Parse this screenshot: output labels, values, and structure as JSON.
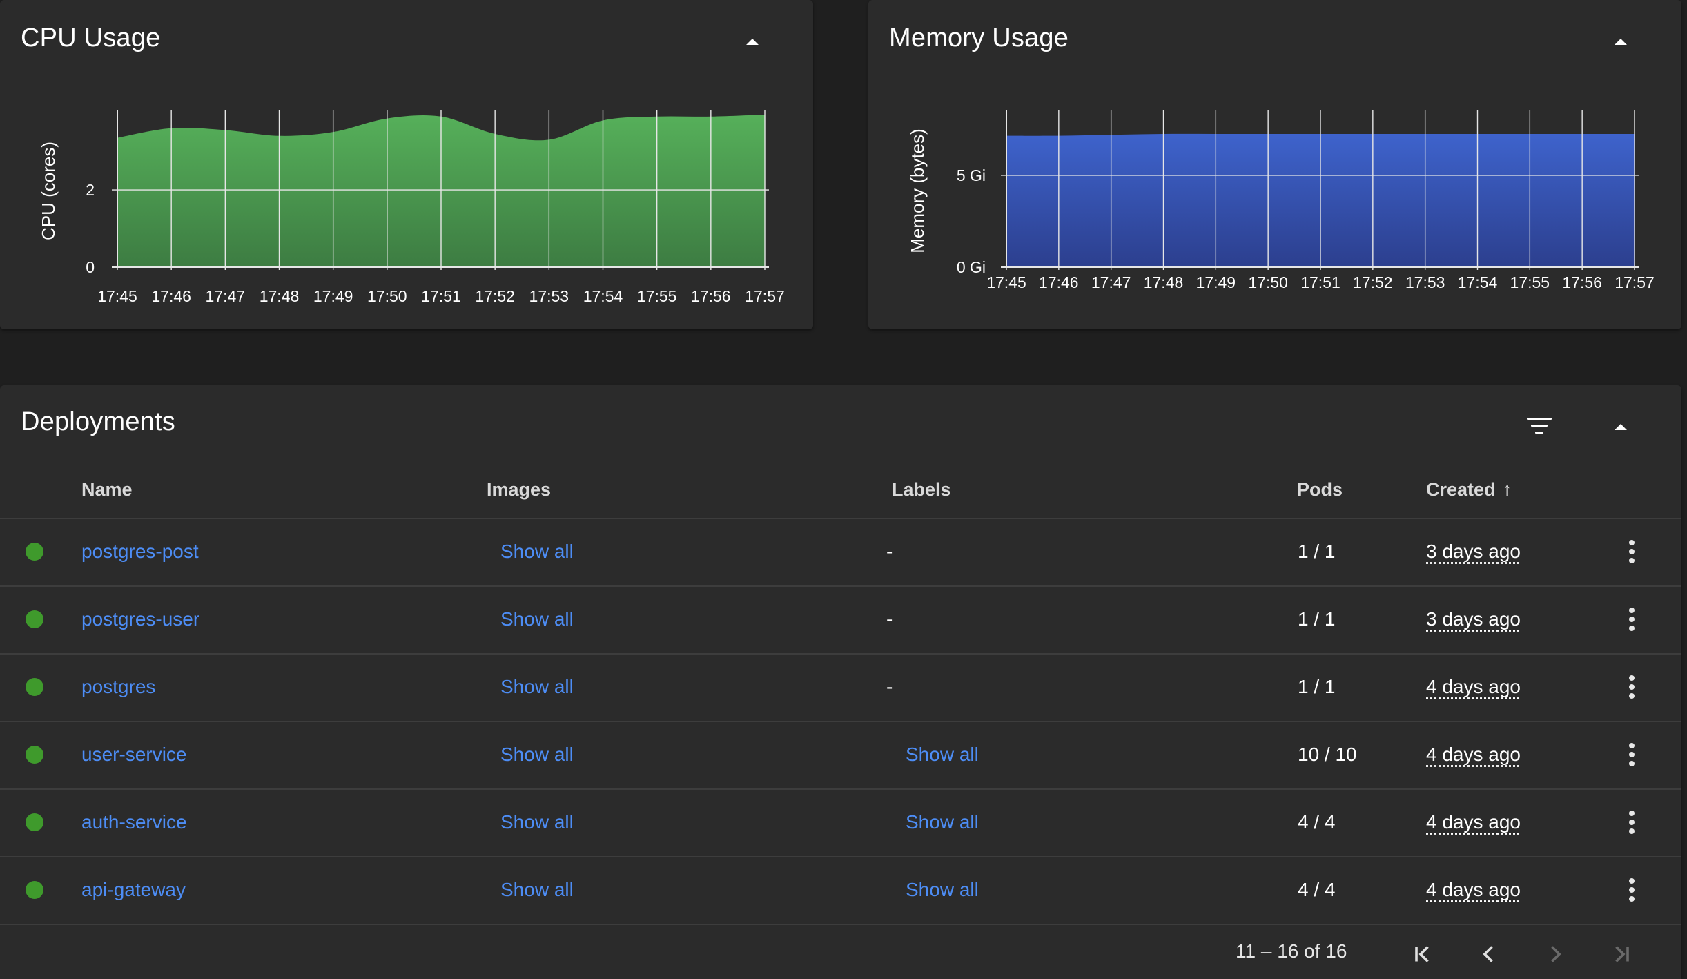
{
  "cpu": {
    "title": "CPU Usage",
    "ylabel": "CPU (cores)",
    "color": "#4caf50"
  },
  "memory": {
    "title": "Memory Usage",
    "ylabel": "Memory (bytes)",
    "color": "#3f5fc4"
  },
  "chart_data": [
    {
      "type": "area",
      "title": "CPU Usage",
      "ylabel": "CPU (cores)",
      "xlabel": "",
      "x": [
        "17:45",
        "17:46",
        "17:47",
        "17:48",
        "17:49",
        "17:50",
        "17:51",
        "17:52",
        "17:53",
        "17:54",
        "17:55",
        "17:56",
        "17:57"
      ],
      "values": [
        3.35,
        3.6,
        3.55,
        3.4,
        3.5,
        3.85,
        3.9,
        3.45,
        3.3,
        3.8,
        3.9,
        3.9,
        3.95
      ],
      "ylim": [
        0,
        3.95
      ],
      "yticks": [
        {
          "v": 0,
          "label": "0"
        },
        {
          "v": 2,
          "label": "2"
        }
      ],
      "grid": true,
      "color": "#4caf50"
    },
    {
      "type": "area",
      "title": "Memory Usage",
      "ylabel": "Memory (bytes)",
      "xlabel": "",
      "x": [
        "17:45",
        "17:46",
        "17:47",
        "17:48",
        "17:49",
        "17:50",
        "17:51",
        "17:52",
        "17:53",
        "17:54",
        "17:55",
        "17:56",
        "17:57"
      ],
      "values": [
        7.15,
        7.15,
        7.2,
        7.25,
        7.25,
        7.25,
        7.25,
        7.25,
        7.25,
        7.25,
        7.25,
        7.25,
        7.25
      ],
      "ylim": [
        0,
        8.3
      ],
      "yticks": [
        {
          "v": 0,
          "label": "0 Gi"
        },
        {
          "v": 5,
          "label": "5 Gi"
        }
      ],
      "grid": true,
      "color": "#3f5fc4"
    }
  ],
  "deployments": {
    "title": "Deployments",
    "columns": {
      "name": "Name",
      "images": "Images",
      "labels": "Labels",
      "pods": "Pods",
      "created": "Created",
      "created_sort": "↑"
    },
    "status_color": "#3f9a2c",
    "rows": [
      {
        "name": "postgres-post",
        "images": "Show all",
        "labels": "-",
        "pods": "1 / 1",
        "created": "3 days ago"
      },
      {
        "name": "postgres-user",
        "images": "Show all",
        "labels": "-",
        "pods": "1 / 1",
        "created": "3 days ago"
      },
      {
        "name": "postgres",
        "images": "Show all",
        "labels": "-",
        "pods": "1 / 1",
        "created": "4 days ago"
      },
      {
        "name": "user-service",
        "images": "Show all",
        "labels": "Show all",
        "pods": "10 / 10",
        "created": "4 days ago"
      },
      {
        "name": "auth-service",
        "images": "Show all",
        "labels": "Show all",
        "pods": "4 / 4",
        "created": "4 days ago"
      },
      {
        "name": "api-gateway",
        "images": "Show all",
        "labels": "Show all",
        "pods": "4 / 4",
        "created": "4 days ago"
      }
    ],
    "pagination": {
      "range_text": "11 – 16 of 16"
    }
  }
}
